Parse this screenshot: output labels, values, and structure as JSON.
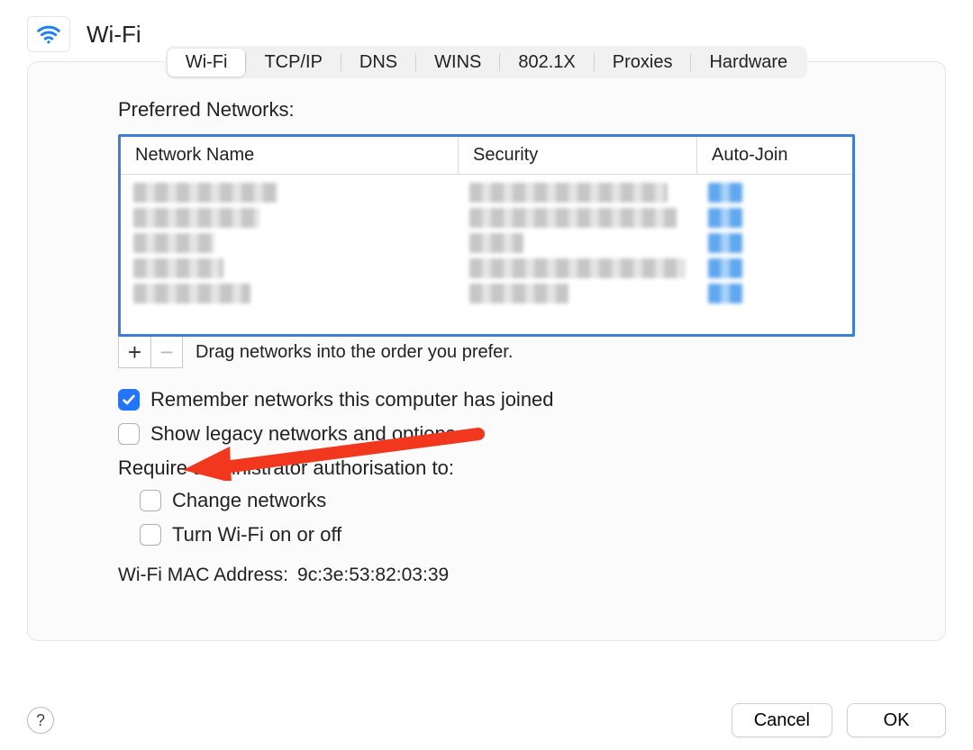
{
  "header": {
    "title": "Wi-Fi"
  },
  "tabs": [
    {
      "label": "Wi-Fi",
      "active": true
    },
    {
      "label": "TCP/IP",
      "active": false
    },
    {
      "label": "DNS",
      "active": false
    },
    {
      "label": "WINS",
      "active": false
    },
    {
      "label": "802.1X",
      "active": false
    },
    {
      "label": "Proxies",
      "active": false
    },
    {
      "label": "Hardware",
      "active": false
    }
  ],
  "preferred": {
    "section_label": "Preferred Networks:",
    "columns": {
      "name": "Network Name",
      "security": "Security",
      "autojoin": "Auto-Join"
    },
    "rows_redacted_count": 5,
    "add_label": "+",
    "remove_label": "−",
    "drag_hint": "Drag networks into the order you prefer."
  },
  "checkboxes": {
    "remember": {
      "label": "Remember networks this computer has joined",
      "checked": true
    },
    "legacy": {
      "label": "Show legacy networks and options",
      "checked": false
    }
  },
  "admin": {
    "heading": "Require administrator authorisation to:",
    "change_networks": {
      "label": "Change networks",
      "checked": false
    },
    "wifi_onoff": {
      "label": "Turn Wi-Fi on or off",
      "checked": false
    }
  },
  "mac_address": {
    "label": "Wi-Fi MAC Address:",
    "value": "9c:3e:53:82:03:39"
  },
  "footer": {
    "help_label": "?",
    "cancel": "Cancel",
    "ok": "OK"
  }
}
